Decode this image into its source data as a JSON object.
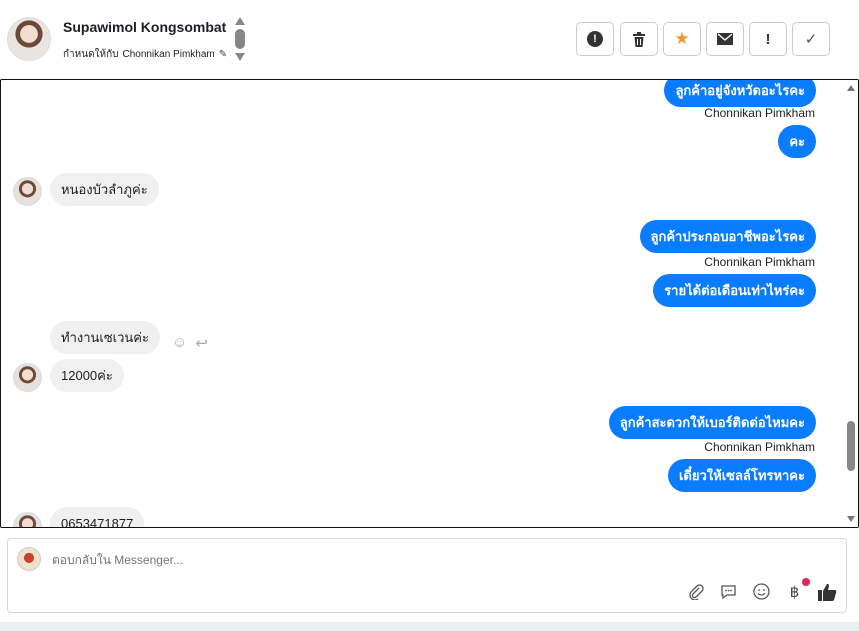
{
  "header": {
    "contact_name": "Supawimol Kongsombat",
    "assign_prefix": "กำหนดให้กับ",
    "assignee": "Chonnikan Pimkham",
    "toolbar": [
      {
        "name": "alert-button",
        "icon": "exclamation-circle-icon"
      },
      {
        "name": "delete-button",
        "icon": "trash-icon"
      },
      {
        "name": "star-button",
        "icon": "star-icon"
      },
      {
        "name": "mail-button",
        "icon": "envelope-icon"
      },
      {
        "name": "important-button",
        "icon": "exclamation-icon"
      },
      {
        "name": "done-button",
        "icon": "check-icon"
      }
    ]
  },
  "messages": {
    "out1": "ลูกค้าอยู่จังหวัดอะไรคะ",
    "sender1": "Chonnikan Pimkham",
    "out2": "คะ",
    "in1": "หนองบัวลำภูค่ะ",
    "out3": "ลูกค้าประกอบอาชีพอะไรคะ",
    "sender2": "Chonnikan Pimkham",
    "out4": "รายได้ต่อเดือนเท่าไหร่คะ",
    "in2": "ทำงานเซเวนค่ะ",
    "in3": "12000ค่ะ",
    "out5": "ลูกค้าสะดวกให้เบอร์ติดต่อไหมคะ",
    "sender3": "Chonnikan Pimkham",
    "out6": "เดี๋ยวให้เซลล์โทรหาคะ",
    "in4": "0653471877"
  },
  "composer": {
    "placeholder": "ตอบกลับใน Messenger..."
  },
  "colors": {
    "outgoing_bubble": "#0a7cff",
    "incoming_bubble": "#f0f0f0",
    "star": "#f5922b",
    "notification_dot": "#e0245e"
  }
}
